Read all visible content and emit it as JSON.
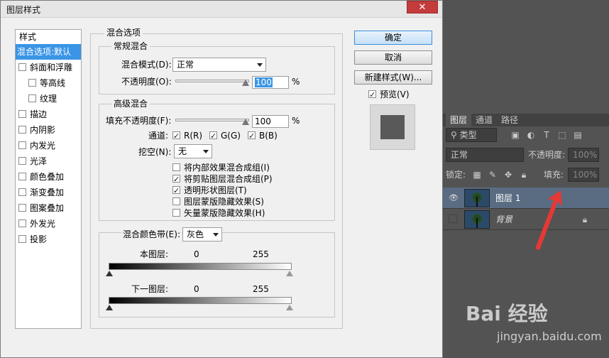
{
  "dialog": {
    "title": "图层样式",
    "close": "✕"
  },
  "stylelist": {
    "header": "样式",
    "items": [
      {
        "label": "混合选项:默认",
        "selected": true,
        "checkbox": false,
        "indent": false
      },
      {
        "label": "斜面和浮雕",
        "checkbox": true,
        "checked": false,
        "indent": false
      },
      {
        "label": "等高线",
        "checkbox": true,
        "checked": false,
        "indent": true
      },
      {
        "label": "纹理",
        "checkbox": true,
        "checked": false,
        "indent": true
      },
      {
        "label": "描边",
        "checkbox": true,
        "checked": false,
        "indent": false
      },
      {
        "label": "内阴影",
        "checkbox": true,
        "checked": false,
        "indent": false
      },
      {
        "label": "内发光",
        "checkbox": true,
        "checked": false,
        "indent": false
      },
      {
        "label": "光泽",
        "checkbox": true,
        "checked": false,
        "indent": false
      },
      {
        "label": "颜色叠加",
        "checkbox": true,
        "checked": false,
        "indent": false
      },
      {
        "label": "渐变叠加",
        "checkbox": true,
        "checked": false,
        "indent": false
      },
      {
        "label": "图案叠加",
        "checkbox": true,
        "checked": false,
        "indent": false
      },
      {
        "label": "外发光",
        "checkbox": true,
        "checked": false,
        "indent": false
      },
      {
        "label": "投影",
        "checkbox": true,
        "checked": false,
        "indent": false
      }
    ]
  },
  "blend": {
    "section": "混合选项",
    "general": {
      "title": "常规混合",
      "mode_label": "混合模式(D):",
      "mode_value": "正常",
      "opacity_label": "不透明度(O):",
      "opacity_value": "100",
      "percent": "%"
    },
    "advanced": {
      "title": "高级混合",
      "fill_label": "填充不透明度(F):",
      "fill_value": "100",
      "percent": "%",
      "channels_label": "通道:",
      "channel_r": "R(R)",
      "channel_g": "G(G)",
      "channel_b": "B(B)",
      "knockout_label": "挖空(N):",
      "knockout_value": "无",
      "options": [
        {
          "label": "将内部效果混合成组(I)",
          "checked": false
        },
        {
          "label": "将剪贴图层混合成组(P)",
          "checked": true
        },
        {
          "label": "透明形状图层(T)",
          "checked": true
        },
        {
          "label": "图层蒙版隐藏效果(S)",
          "checked": false
        },
        {
          "label": "矢量蒙版隐藏效果(H)",
          "checked": false
        }
      ]
    },
    "blendif": {
      "label": "混合颜色带(E):",
      "value": "灰色",
      "this_layer": "本图层:",
      "underlying": "下一图层:",
      "min": "0",
      "max": "255"
    }
  },
  "buttons": {
    "ok": "确定",
    "cancel": "取消",
    "new_style": "新建样式(W)...",
    "preview": "预览(V)"
  },
  "panel": {
    "tabs": [
      "图层",
      "通道",
      "路径"
    ],
    "kind": "类型",
    "mode": "正常",
    "opacity_label": "不透明度:",
    "opacity_value": "100%",
    "lock_label": "锁定:",
    "fill_label": "填充:",
    "fill_value": "100%",
    "layers": [
      {
        "name": "图层 1",
        "selected": true,
        "visible": true
      },
      {
        "name": "背景",
        "selected": false,
        "visible": false,
        "locked": true
      }
    ]
  },
  "watermark": {
    "brand": "Bai 经验",
    "url": "jingyan.baidu.com"
  },
  "colors": {
    "accent": "#3a95e6",
    "panel_bg": "#535353",
    "arrow": "#e53935"
  }
}
